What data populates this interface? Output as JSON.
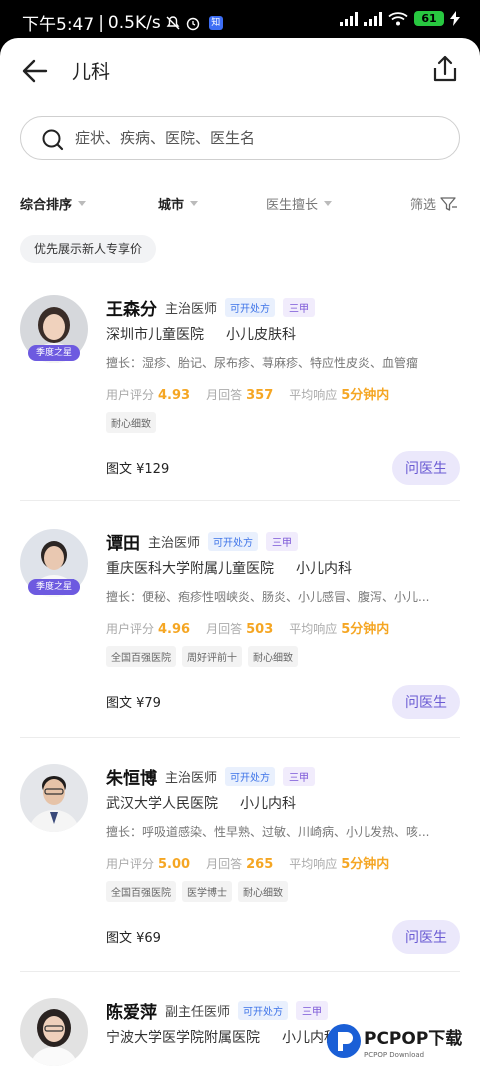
{
  "status_bar": {
    "time": "下午5:47",
    "speed": "0.5K/s",
    "app_badge": "知",
    "battery": "61"
  },
  "header": {
    "back_icon": "arrow-left-icon",
    "title": "儿科",
    "share_icon": "share-icon"
  },
  "search": {
    "placeholder": "症状、疾病、医院、医生名",
    "icon": "search-icon"
  },
  "filters": [
    {
      "label": "综合排序"
    },
    {
      "label": "城市"
    },
    {
      "label": "医生擅长"
    },
    {
      "label": "筛选"
    }
  ],
  "promo": "优先展示新人专享价",
  "stat_labels": {
    "rating": "用户评分",
    "monthly": "月回答",
    "response": "平均响应"
  },
  "badge_text": "季度之星",
  "ask_label": "问医生",
  "doctors": [
    {
      "name": "王森分",
      "title": "主治医师",
      "tag_prescription": "可开处方",
      "tag_grade": "三甲",
      "hospital": "深圳市儿童医院",
      "dept": "小儿皮肤科",
      "skill": "擅长：湿疹、胎记、尿布疹、荨麻疹、特应性皮炎、血管瘤",
      "rating": "4.93",
      "monthly": "357",
      "response": "5分钟内",
      "labels": [
        "耐心细致"
      ],
      "price": "图文 ¥129"
    },
    {
      "name": "谭田",
      "title": "主治医师",
      "tag_prescription": "可开处方",
      "tag_grade": "三甲",
      "hospital": "重庆医科大学附属儿童医院",
      "dept": "小儿内科",
      "skill": "擅长：便秘、疱疹性咽峡炎、肠炎、小儿感冒、腹泻、小儿...",
      "rating": "4.96",
      "monthly": "503",
      "response": "5分钟内",
      "labels": [
        "全国百强医院",
        "周好评前十",
        "耐心细致"
      ],
      "price": "图文 ¥79"
    },
    {
      "name": "朱恒博",
      "title": "主治医师",
      "tag_prescription": "可开处方",
      "tag_grade": "三甲",
      "hospital": "武汉大学人民医院",
      "dept": "小儿内科",
      "skill": "擅长：呼吸道感染、性早熟、过敏、川崎病、小儿发热、咳...",
      "rating": "5.00",
      "monthly": "265",
      "response": "5分钟内",
      "labels": [
        "全国百强医院",
        "医学博士",
        "耐心细致"
      ],
      "price": "图文 ¥69"
    },
    {
      "name": "陈爱萍",
      "title": "副主任医师",
      "tag_prescription": "可开处方",
      "tag_grade": "三甲",
      "hospital": "宁波大学医学院附属医院",
      "dept": "小儿内科"
    }
  ],
  "watermark": {
    "brand": "PCPOP下载",
    "sub": "PCPOP Download"
  },
  "colors": {
    "accent": "#6a5ad3",
    "rating": "#f5a623",
    "tag_blue": "#3d73e8",
    "badge": "#6d5ae0"
  }
}
